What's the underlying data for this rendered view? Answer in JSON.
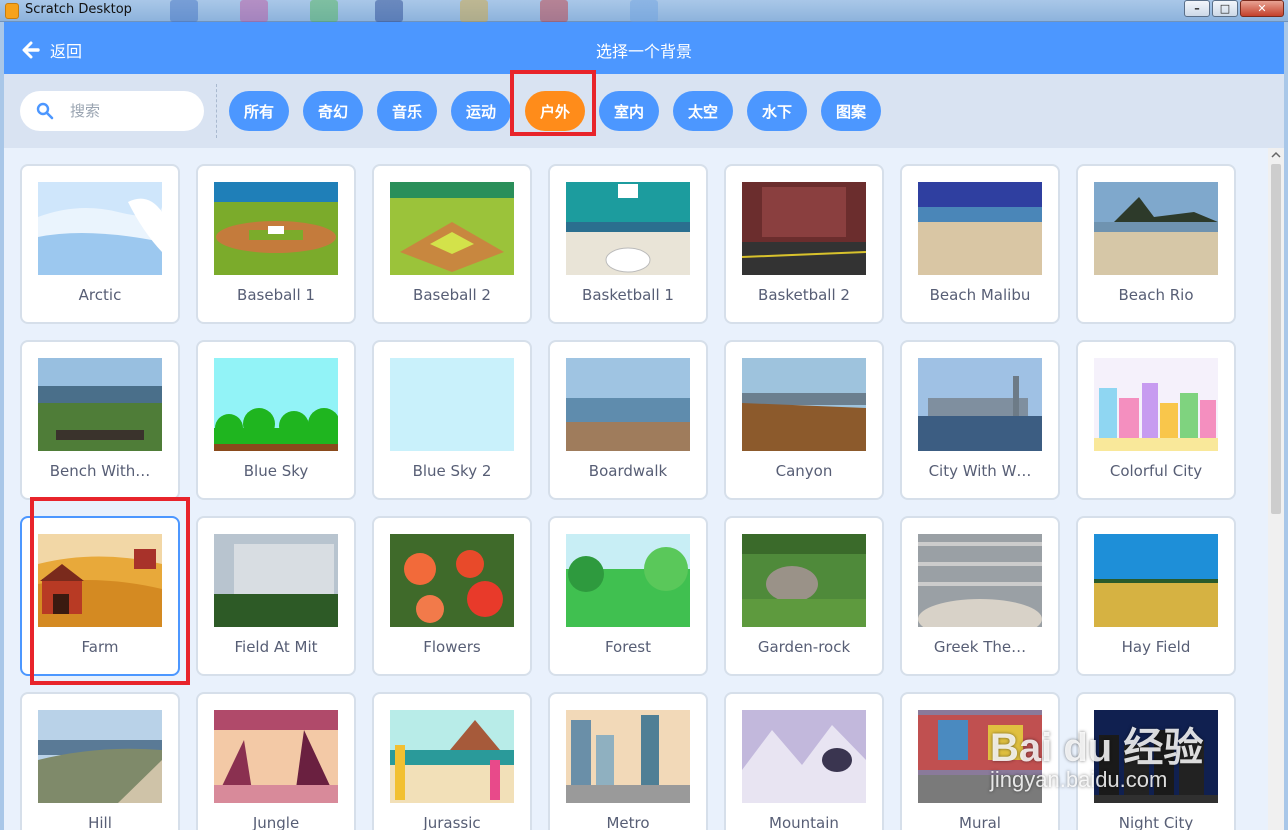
{
  "window": {
    "title": "Scratch Desktop"
  },
  "header": {
    "back_label": "返回",
    "title": "选择一个背景"
  },
  "search": {
    "placeholder": "搜索"
  },
  "tags": [
    {
      "label": "所有",
      "active": false
    },
    {
      "label": "奇幻",
      "active": false
    },
    {
      "label": "音乐",
      "active": false
    },
    {
      "label": "运动",
      "active": false
    },
    {
      "label": "户外",
      "active": true
    },
    {
      "label": "室内",
      "active": false
    },
    {
      "label": "太空",
      "active": false
    },
    {
      "label": "水下",
      "active": false
    },
    {
      "label": "图案",
      "active": false
    }
  ],
  "backdrops": [
    {
      "name": "Arctic",
      "theme": "arctic"
    },
    {
      "name": "Baseball 1",
      "theme": "baseball1"
    },
    {
      "name": "Baseball 2",
      "theme": "baseball2"
    },
    {
      "name": "Basketball 1",
      "theme": "basketball1"
    },
    {
      "name": "Basketball 2",
      "theme": "basketball2"
    },
    {
      "name": "Beach Malibu",
      "theme": "beach"
    },
    {
      "name": "Beach Rio",
      "theme": "beachrio"
    },
    {
      "name": "Bench With…",
      "theme": "bench"
    },
    {
      "name": "Blue Sky",
      "theme": "bluesky"
    },
    {
      "name": "Blue Sky 2",
      "theme": "bluesky2"
    },
    {
      "name": "Boardwalk",
      "theme": "boardwalk"
    },
    {
      "name": "Canyon",
      "theme": "canyon"
    },
    {
      "name": "City With W…",
      "theme": "citywater"
    },
    {
      "name": "Colorful City",
      "theme": "colorfulcity"
    },
    {
      "name": "Farm",
      "theme": "farm",
      "selected": true
    },
    {
      "name": "Field At Mit",
      "theme": "mit"
    },
    {
      "name": "Flowers",
      "theme": "flowers"
    },
    {
      "name": "Forest",
      "theme": "forest"
    },
    {
      "name": "Garden-rock",
      "theme": "garden"
    },
    {
      "name": "Greek The…",
      "theme": "greek"
    },
    {
      "name": "Hay Field",
      "theme": "hayfield"
    },
    {
      "name": "Hill",
      "theme": "hill"
    },
    {
      "name": "Jungle",
      "theme": "jungle"
    },
    {
      "name": "Jurassic",
      "theme": "jurassic"
    },
    {
      "name": "Metro",
      "theme": "metro"
    },
    {
      "name": "Mountain",
      "theme": "mountain"
    },
    {
      "name": "Mural",
      "theme": "mural"
    },
    {
      "name": "Night City",
      "theme": "nightcity"
    }
  ],
  "watermark": {
    "line1": "Bai du 经验",
    "line2": "jingyan.baidu.com"
  }
}
